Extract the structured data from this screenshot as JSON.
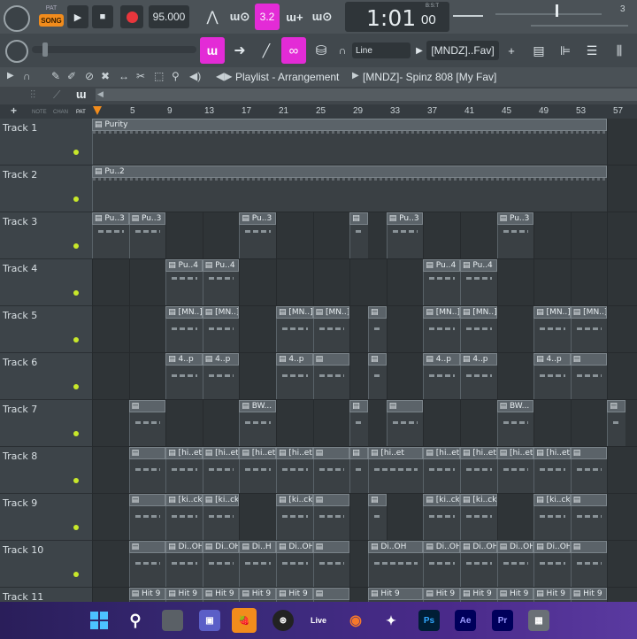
{
  "transport": {
    "song_label": "SONG",
    "pat_label": "PAT",
    "tempo": "95.000",
    "time_main": "1:01",
    "time_sub": "00",
    "time_unit": "B:S:T",
    "num_right": "3"
  },
  "toolbar2": {
    "snap_mode": "Line",
    "preset": "[MNDZ]..Fav]",
    "add": "+"
  },
  "titlebar": {
    "title": "Playlist - Arrangement",
    "breadcrumb": "[MNDZ]- Spinz 808 [My Fav]"
  },
  "subbar": {
    "labels": [
      "NOTE",
      "CHAN",
      "PAT"
    ]
  },
  "ruler": {
    "marks": [
      "5",
      "9",
      "13",
      "17",
      "21",
      "25",
      "29",
      "33",
      "37",
      "41",
      "45",
      "49",
      "53",
      "57"
    ]
  },
  "tracks": [
    {
      "name": "Track 1",
      "clips": [
        {
          "s": 0,
          "e": 14,
          "label": "Purity"
        }
      ]
    },
    {
      "name": "Track 2",
      "clips": [
        {
          "s": 0,
          "e": 14,
          "label": "Pu..2"
        }
      ]
    },
    {
      "name": "Track 3",
      "clips": [
        {
          "s": 0,
          "e": 1,
          "label": "Pu..3"
        },
        {
          "s": 1,
          "e": 2,
          "label": "Pu..3"
        },
        {
          "s": 4,
          "e": 5,
          "label": "Pu..3"
        },
        {
          "s": 7,
          "e": 7.5,
          "label": ""
        },
        {
          "s": 8,
          "e": 9,
          "label": "Pu..3"
        },
        {
          "s": 11,
          "e": 12,
          "label": "Pu..3"
        }
      ]
    },
    {
      "name": "Track 4",
      "clips": [
        {
          "s": 2,
          "e": 3,
          "label": "Pu..4"
        },
        {
          "s": 3,
          "e": 4,
          "label": "Pu..4"
        },
        {
          "s": 9,
          "e": 10,
          "label": "Pu..4"
        },
        {
          "s": 10,
          "e": 11,
          "label": "Pu..4"
        }
      ]
    },
    {
      "name": "Track 5",
      "clips": [
        {
          "s": 2,
          "e": 3,
          "label": "[MN..]"
        },
        {
          "s": 3,
          "e": 4,
          "label": "[MN..]"
        },
        {
          "s": 5,
          "e": 6,
          "label": "[MN..]"
        },
        {
          "s": 6,
          "e": 7,
          "label": "[MN..]"
        },
        {
          "s": 7.5,
          "e": 8,
          "label": ""
        },
        {
          "s": 9,
          "e": 10,
          "label": "[MN..]"
        },
        {
          "s": 10,
          "e": 11,
          "label": "[MN..]"
        },
        {
          "s": 12,
          "e": 13,
          "label": "[MN..]"
        },
        {
          "s": 13,
          "e": 14,
          "label": "[MN..]"
        }
      ]
    },
    {
      "name": "Track 6",
      "clips": [
        {
          "s": 2,
          "e": 3,
          "label": "4..p"
        },
        {
          "s": 3,
          "e": 4,
          "label": "4..p"
        },
        {
          "s": 5,
          "e": 6,
          "label": "4..p"
        },
        {
          "s": 6,
          "e": 7,
          "label": ""
        },
        {
          "s": 7.5,
          "e": 8,
          "label": ""
        },
        {
          "s": 9,
          "e": 10,
          "label": "4..p"
        },
        {
          "s": 10,
          "e": 11,
          "label": "4..p"
        },
        {
          "s": 12,
          "e": 13,
          "label": "4..p"
        },
        {
          "s": 13,
          "e": 14,
          "label": ""
        }
      ]
    },
    {
      "name": "Track 7",
      "clips": [
        {
          "s": 1,
          "e": 2,
          "label": ""
        },
        {
          "s": 4,
          "e": 5,
          "label": "BW..."
        },
        {
          "s": 7,
          "e": 7.5,
          "label": ""
        },
        {
          "s": 8,
          "e": 9,
          "label": ""
        },
        {
          "s": 11,
          "e": 12,
          "label": "BW..."
        },
        {
          "s": 14,
          "e": 14.5,
          "label": ""
        }
      ]
    },
    {
      "name": "Track 8",
      "clips": [
        {
          "s": 1,
          "e": 2,
          "label": ""
        },
        {
          "s": 2,
          "e": 3,
          "label": "[hi..et"
        },
        {
          "s": 3,
          "e": 4,
          "label": "[hi..et"
        },
        {
          "s": 4,
          "e": 5,
          "label": "[hi..et"
        },
        {
          "s": 5,
          "e": 6,
          "label": "[hi..et"
        },
        {
          "s": 6,
          "e": 7,
          "label": ""
        },
        {
          "s": 7,
          "e": 7.5,
          "label": ""
        },
        {
          "s": 7.5,
          "e": 9,
          "label": "[hi..et"
        },
        {
          "s": 9,
          "e": 10,
          "label": "[hi..et"
        },
        {
          "s": 10,
          "e": 11,
          "label": "[hi..et"
        },
        {
          "s": 11,
          "e": 12,
          "label": "[hi..et"
        },
        {
          "s": 12,
          "e": 13,
          "label": "[hi..et"
        },
        {
          "s": 13,
          "e": 14,
          "label": ""
        }
      ]
    },
    {
      "name": "Track 9",
      "clips": [
        {
          "s": 1,
          "e": 2,
          "label": ""
        },
        {
          "s": 2,
          "e": 3,
          "label": "[ki..ck"
        },
        {
          "s": 3,
          "e": 4,
          "label": "[ki..ck"
        },
        {
          "s": 5,
          "e": 6,
          "label": "[ki..ck"
        },
        {
          "s": 6,
          "e": 7,
          "label": ""
        },
        {
          "s": 7.5,
          "e": 8,
          "label": ""
        },
        {
          "s": 9,
          "e": 10,
          "label": "[ki..ck"
        },
        {
          "s": 10,
          "e": 11,
          "label": "[ki..ck"
        },
        {
          "s": 12,
          "e": 13,
          "label": "[ki..ck"
        },
        {
          "s": 13,
          "e": 14,
          "label": ""
        }
      ]
    },
    {
      "name": "Track 10",
      "clips": [
        {
          "s": 1,
          "e": 2,
          "label": ""
        },
        {
          "s": 2,
          "e": 3,
          "label": "Di..OH"
        },
        {
          "s": 3,
          "e": 4,
          "label": "Di..OH"
        },
        {
          "s": 4,
          "e": 5,
          "label": "Di..H"
        },
        {
          "s": 5,
          "e": 6,
          "label": "Di..OH"
        },
        {
          "s": 6,
          "e": 7,
          "label": ""
        },
        {
          "s": 7.5,
          "e": 9,
          "label": "Di..OH"
        },
        {
          "s": 9,
          "e": 10,
          "label": "Di..OH"
        },
        {
          "s": 10,
          "e": 11,
          "label": "Di..OH"
        },
        {
          "s": 11,
          "e": 12,
          "label": "Di..OH"
        },
        {
          "s": 12,
          "e": 13,
          "label": "Di..OH"
        },
        {
          "s": 13,
          "e": 14,
          "label": ""
        }
      ]
    },
    {
      "name": "Track 11",
      "clips": [
        {
          "s": 1,
          "e": 2,
          "label": "Hit 9"
        },
        {
          "s": 2,
          "e": 3,
          "label": "Hit 9"
        },
        {
          "s": 3,
          "e": 4,
          "label": "Hit 9"
        },
        {
          "s": 4,
          "e": 5,
          "label": "Hit 9"
        },
        {
          "s": 5,
          "e": 6,
          "label": "Hit 9"
        },
        {
          "s": 6,
          "e": 7,
          "label": ""
        },
        {
          "s": 7.5,
          "e": 9,
          "label": "Hit 9"
        },
        {
          "s": 9,
          "e": 10,
          "label": "Hit 9"
        },
        {
          "s": 10,
          "e": 11,
          "label": "Hit 9"
        },
        {
          "s": 11,
          "e": 12,
          "label": "Hit 9"
        },
        {
          "s": 12,
          "e": 13,
          "label": "Hit 9"
        },
        {
          "s": 13,
          "e": 14,
          "label": "Hit 9"
        }
      ]
    }
  ],
  "taskbar": {
    "apps": [
      "windows-start",
      "search",
      "file-explorer",
      "teams",
      "fl-studio",
      "obs",
      "live",
      "blender",
      "app-9",
      "photoshop",
      "after-effects",
      "premiere",
      "calculator"
    ],
    "labels": {
      "live": "Live",
      "photoshop": "Ps",
      "after-effects": "Ae",
      "premiere": "Pr"
    }
  },
  "colors": {
    "accent_pink": "#e32bd6",
    "led_green": "#c8e82a",
    "record_red": "#e8363c"
  }
}
